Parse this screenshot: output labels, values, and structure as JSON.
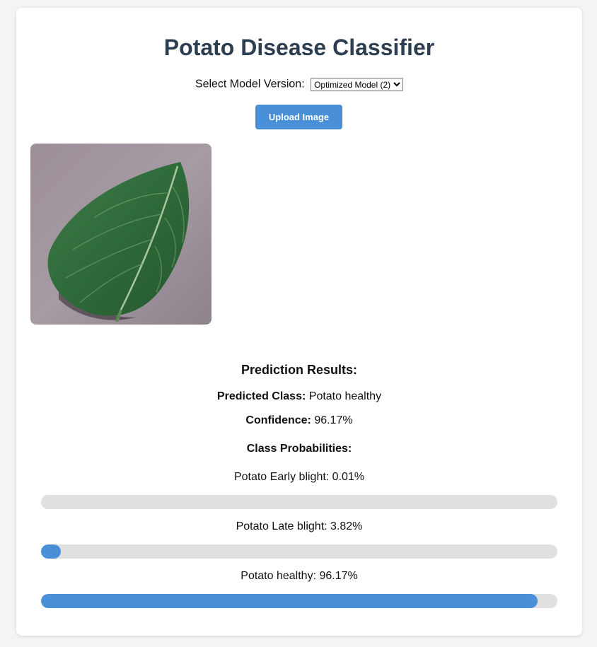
{
  "title": "Potato Disease Classifier",
  "model_select": {
    "label": "Select Model Version:",
    "selected": "Optimized Model (2)"
  },
  "upload_button": "Upload Image",
  "results": {
    "heading": "Prediction Results:",
    "predicted_class_label": "Predicted Class:",
    "predicted_class_value": "Potato healthy",
    "confidence_label": "Confidence:",
    "confidence_value": "96.17%",
    "probabilities_heading": "Class Probabilities:",
    "probabilities": [
      {
        "label": "Potato Early blight: 0.01%",
        "value": 0.0001
      },
      {
        "label": "Potato Late blight: 3.82%",
        "value": 0.0382
      },
      {
        "label": "Potato healthy: 96.17%",
        "value": 0.9617
      }
    ]
  },
  "colors": {
    "accent": "#4a90d9",
    "title": "#2c3e50",
    "track": "#e0e0e0"
  }
}
